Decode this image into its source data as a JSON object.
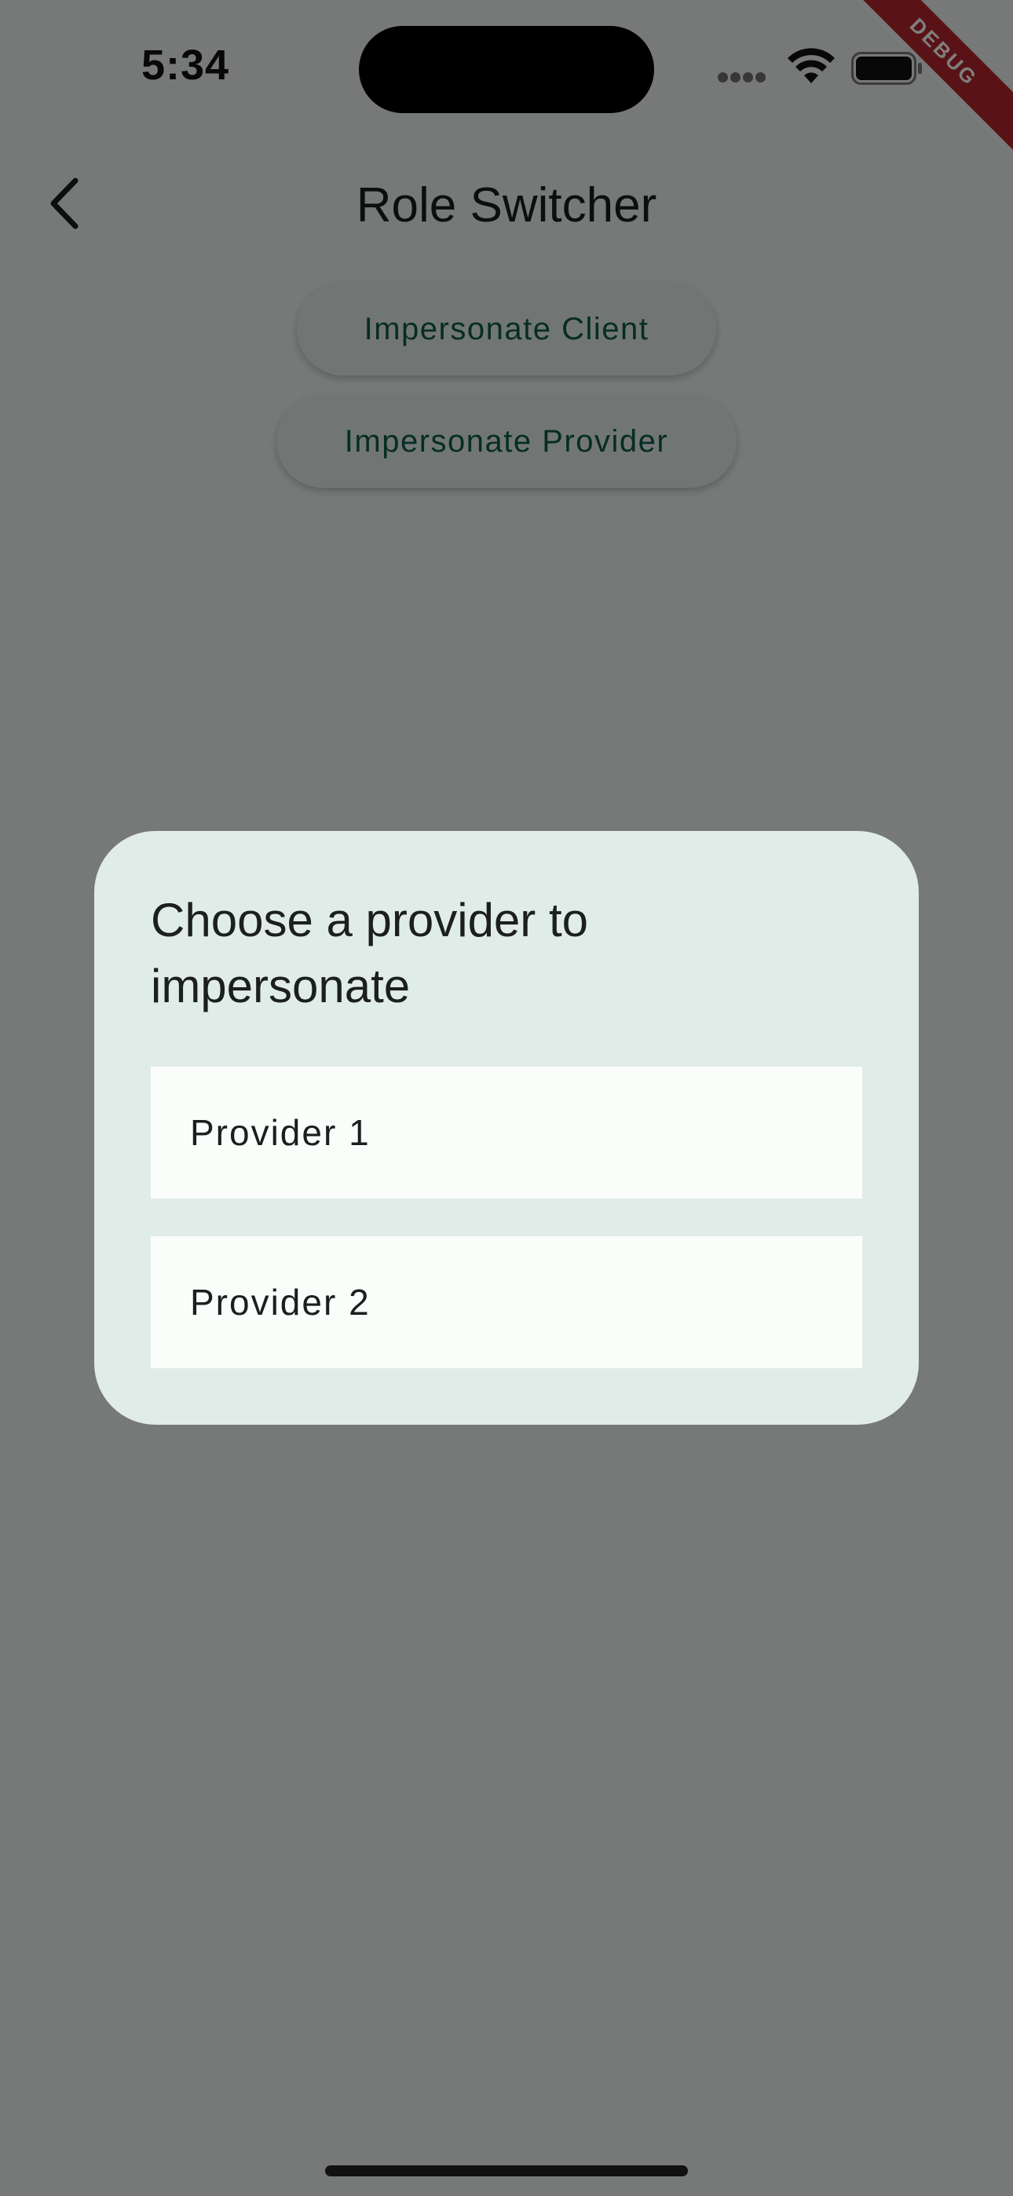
{
  "status_bar": {
    "time": "5:34"
  },
  "debug_banner": "DEBUG",
  "app_bar": {
    "title": "Role Switcher",
    "back_icon": "chevron-left-icon"
  },
  "actions": {
    "impersonate_client": "Impersonate Client",
    "impersonate_provider": "Impersonate Provider"
  },
  "dialog": {
    "title": "Choose a provider to impersonate",
    "options": [
      {
        "label": "Provider 1"
      },
      {
        "label": "Provider 2"
      }
    ]
  },
  "colors": {
    "accent_text": "#0d5a48",
    "dialog_background": "#e0ece8",
    "option_background": "#fbfdfb",
    "debug_ribbon": "#b3262c"
  }
}
